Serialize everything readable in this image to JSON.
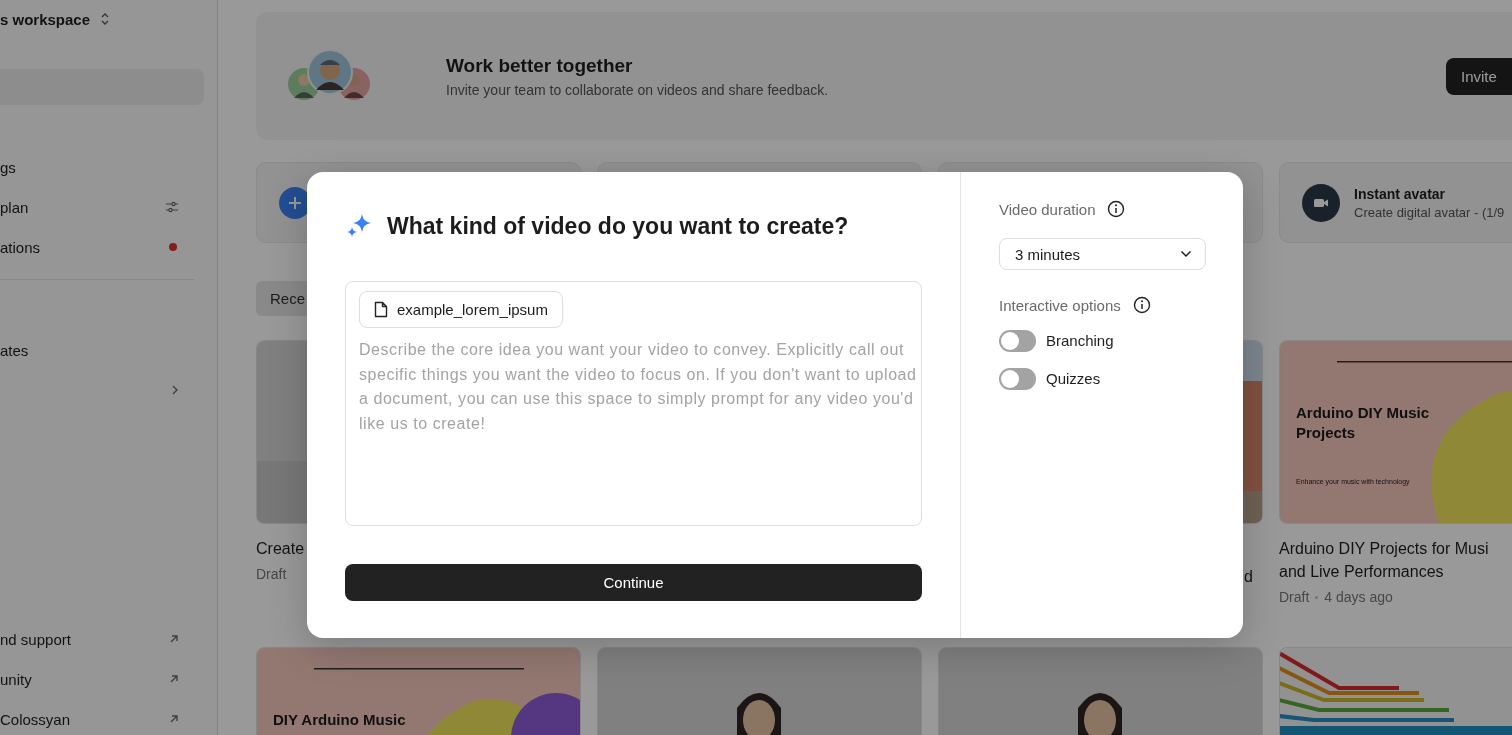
{
  "sidebar": {
    "workspace": "s workspace",
    "top_items": [
      {
        "label": "gs",
        "kind": "plain"
      },
      {
        "label": "plan",
        "kind": "settings"
      },
      {
        "label": "ations",
        "kind": "alert"
      }
    ],
    "mid_items": [
      {
        "label": "ates",
        "kind": "plain"
      },
      {
        "kind": "submenu"
      }
    ],
    "bottom_items": [
      {
        "label": "nd support",
        "kind": "external"
      },
      {
        "label": "unity",
        "kind": "external"
      },
      {
        "label": "Colossyan",
        "kind": "external"
      }
    ]
  },
  "banner": {
    "title": "Work better together",
    "subtitle": "Invite your team to collaborate on videos and share feedback.",
    "button": "Invite"
  },
  "actions": [
    {
      "kind": "add"
    },
    {
      "kind": "blank"
    },
    {
      "kind": "blank"
    },
    {
      "kind": "avatar",
      "title": "Instant avatar",
      "subtitle": "Create digital avatar - (1/9"
    }
  ],
  "tabs": [
    {
      "label": "Rece",
      "selected": true
    }
  ],
  "videos": [
    {
      "kind": "presenter",
      "title": "Create",
      "status": "Draft"
    },
    {
      "kind": "blank"
    },
    {
      "kind": "street",
      "title": "d"
    },
    {
      "kind": "slide",
      "slide_title": "Arduino DIY Music Projects",
      "slide_caption": "Enhance your music with technology",
      "title": "Arduino DIY Projects for Musi",
      "title_2": "and Live Performances",
      "status": "Draft",
      "age": "4 days ago"
    },
    {
      "kind": "slide",
      "slide_title": "DIY Arduino Music"
    },
    {
      "kind": "presenter"
    },
    {
      "kind": "presenter"
    },
    {
      "kind": "chart"
    }
  ],
  "dialog": {
    "title": "What kind of video do you want to create?",
    "file": "example_lorem_ipsum",
    "placeholder": "Describe the core idea you want your video to convey. Explicitly call out specific things you want the video to focus on. If you don't want to upload a document, you can use this space to simply prompt for any video you'd like us to create!",
    "button": "Continue",
    "duration_label": "Video duration",
    "duration": "3 minutes",
    "interactive_label": "Interactive options",
    "toggles": [
      {
        "label": "Branching",
        "on": false
      },
      {
        "label": "Quizzes",
        "on": false
      }
    ]
  }
}
